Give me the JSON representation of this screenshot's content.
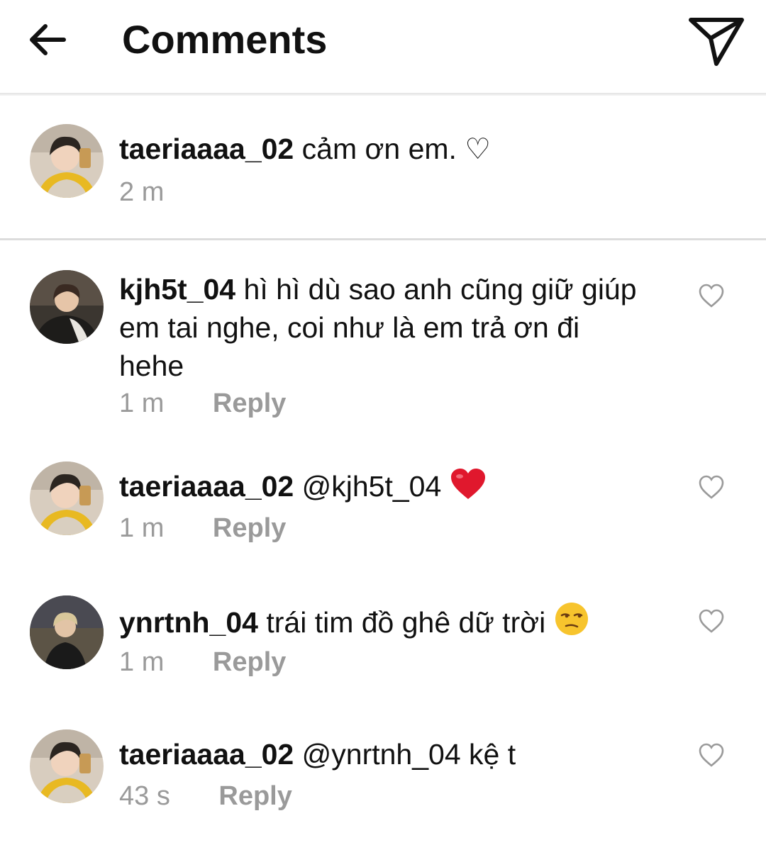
{
  "header": {
    "title": "Comments",
    "back_icon": "arrow-left-icon",
    "share_icon": "paper-plane-icon"
  },
  "caption": {
    "username": "taeriaaaa_02",
    "text": "cảm ơn em. ♡",
    "time": "2 m"
  },
  "comments": [
    {
      "username": "kjh5t_04",
      "text": "hì hì dù sao anh cũng giữ giúp em tai nghe, coi như là em trả ơn đi hehe",
      "time": "1 m",
      "reply_label": "Reply"
    },
    {
      "username": "taeriaaaa_02",
      "text": "@kjh5t_04",
      "emoji": "red-heart-emoji",
      "time": "1 m",
      "reply_label": "Reply"
    },
    {
      "username": "ynrtnh_04",
      "text": "trái tim đồ ghê dữ trời",
      "emoji": "unamused-face-emoji",
      "time": "1 m",
      "reply_label": "Reply"
    },
    {
      "username": "taeriaaaa_02",
      "text": "@ynrtnh_04 kệ t",
      "time": "43 s",
      "reply_label": "Reply"
    }
  ],
  "colors": {
    "text": "#111111",
    "meta": "#9a9a9a",
    "heart": "#e0182d",
    "divider": "#dcdcdc"
  }
}
